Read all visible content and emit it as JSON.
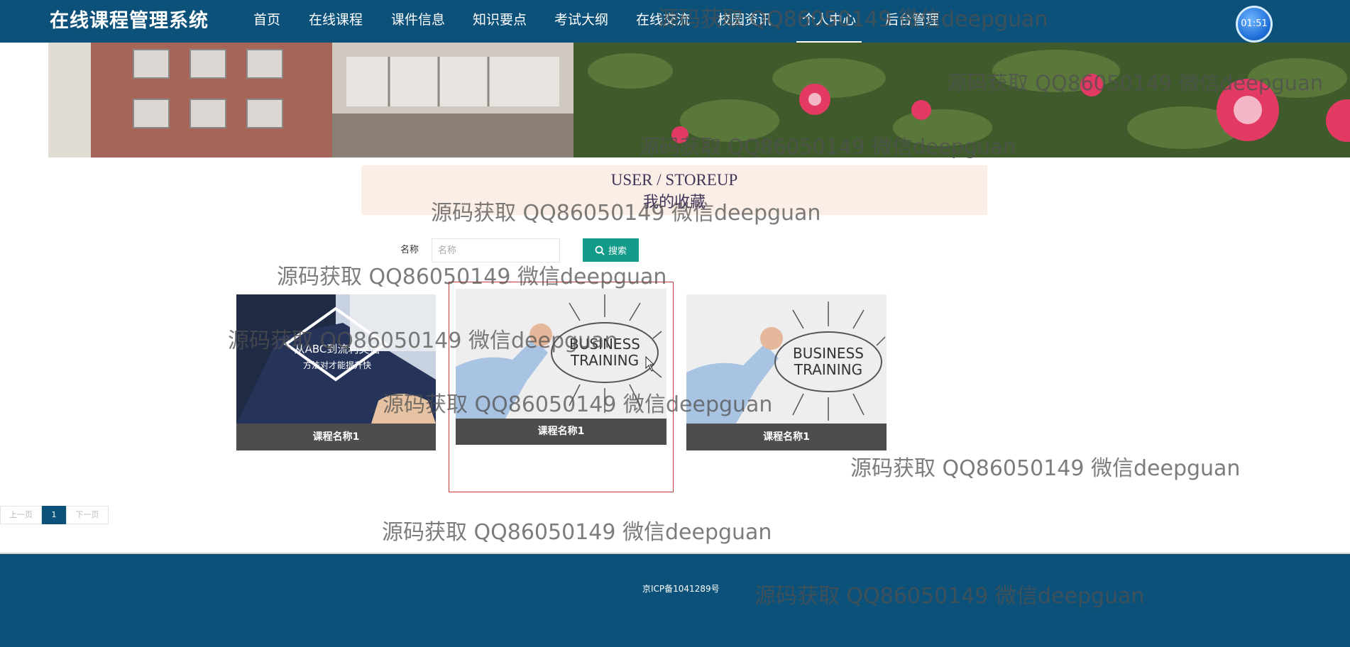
{
  "app": {
    "brand": "在线课程管理系统"
  },
  "nav": {
    "items": [
      {
        "label": "首页"
      },
      {
        "label": "在线课程"
      },
      {
        "label": "课件信息"
      },
      {
        "label": "知识要点"
      },
      {
        "label": "考试大纲"
      },
      {
        "label": "在线交流"
      },
      {
        "label": "校园资讯"
      },
      {
        "label": "个人中心",
        "active": true
      },
      {
        "label": "后台管理"
      }
    ],
    "avatar_text": "01:51"
  },
  "title": {
    "en": "USER / STOREUP",
    "cn": "我的收藏"
  },
  "search": {
    "label": "名称",
    "placeholder": "名称",
    "button_label": "搜索",
    "icon": "search-icon"
  },
  "cards": [
    {
      "caption": "课程名称1",
      "image_text": [
        "从ABC到流利英语",
        "方法对才能提升快"
      ]
    },
    {
      "caption": "课程名称1",
      "image_text": [
        "BUSINESS",
        "TRAINING"
      ]
    },
    {
      "caption": "课程名称1",
      "image_text": [
        "BUSINESS",
        "TRAINING"
      ]
    }
  ],
  "pagination": {
    "prev": "上一页",
    "current": "1",
    "next": "下一页"
  },
  "footer": {
    "icp": "京ICP备1041289号"
  },
  "watermark": "源码获取 QQ86050149 微信deepguan",
  "colors": {
    "navbar": "#0b5179",
    "search_button": "#129a8a",
    "title_block": "#fbeee6",
    "caption": "#4d4d4d"
  }
}
